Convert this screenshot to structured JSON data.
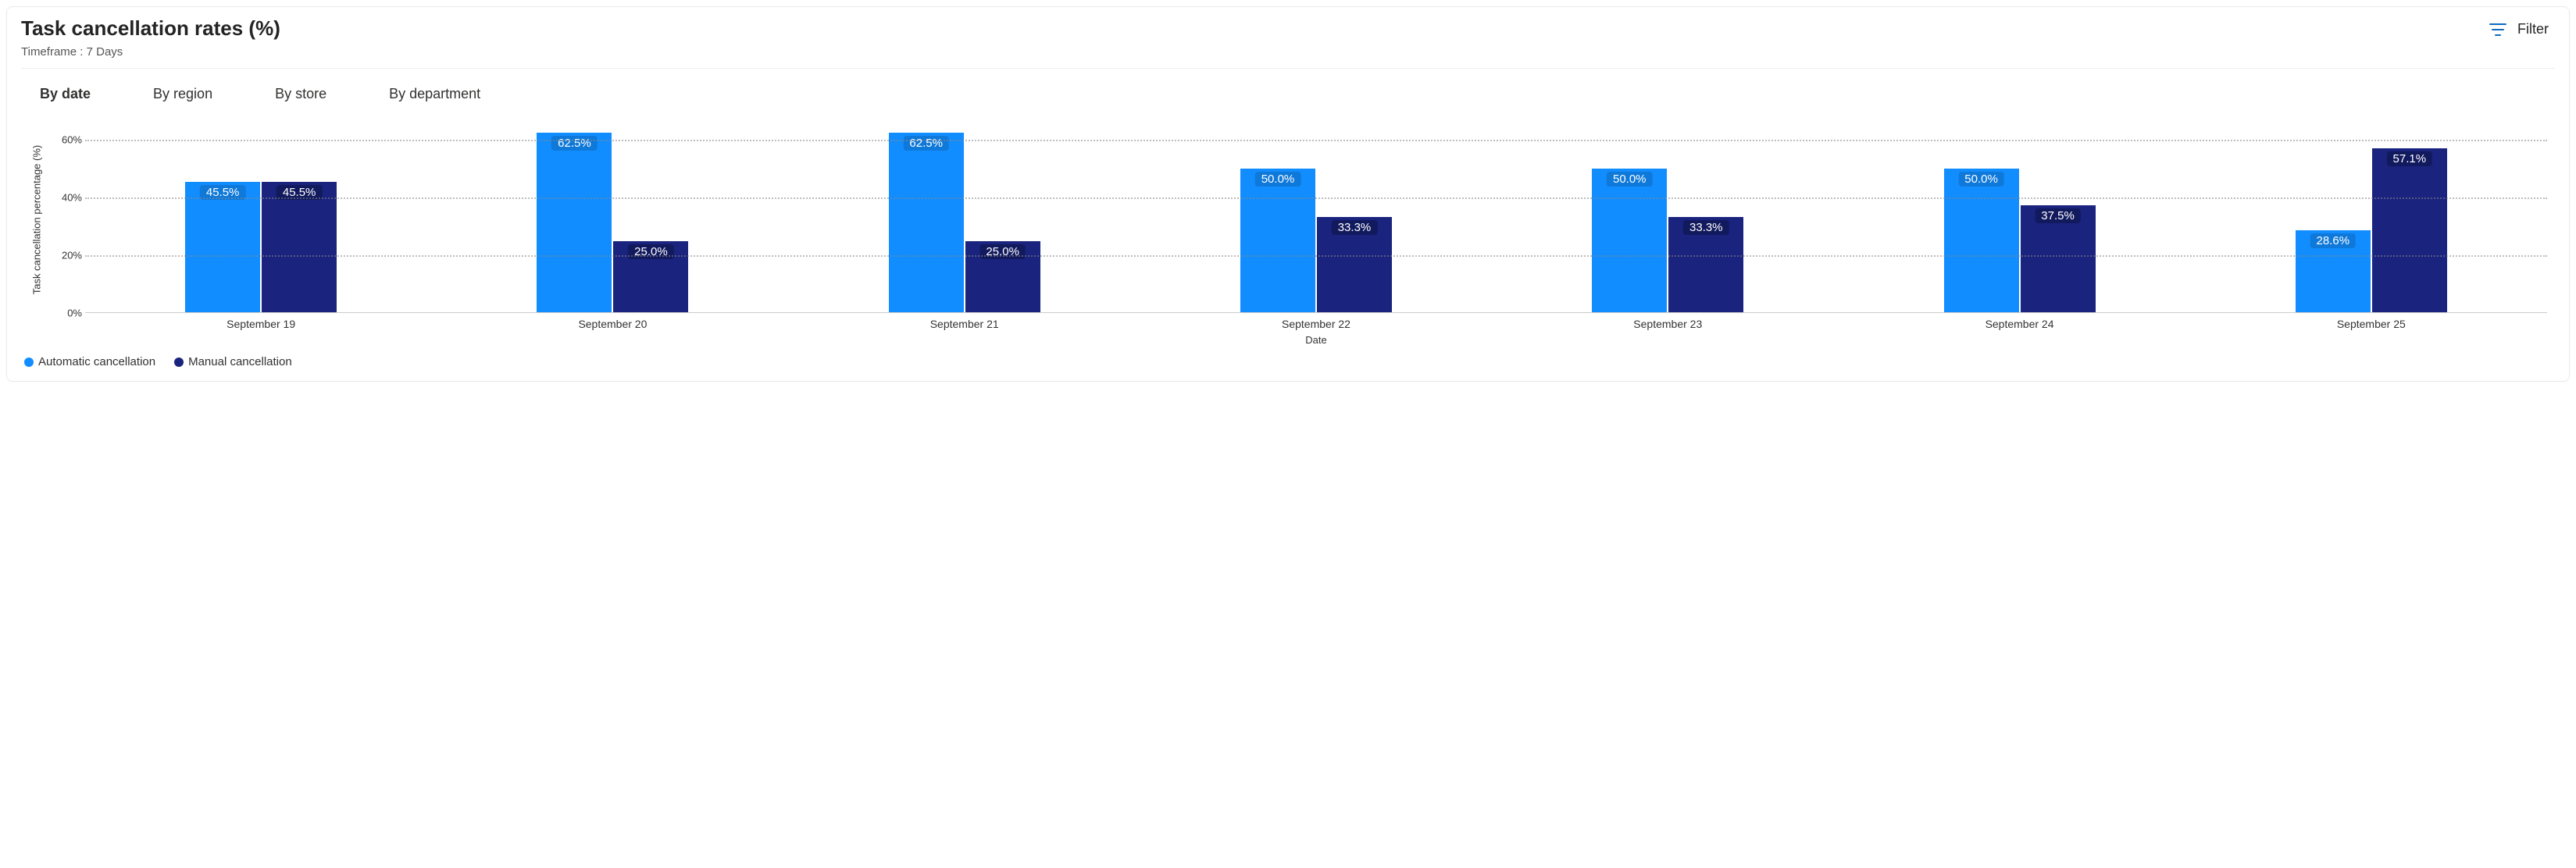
{
  "header": {
    "title": "Task cancellation rates (%)",
    "subtitle": "Timeframe : 7 Days",
    "filter_label": "Filter"
  },
  "tabs": {
    "items": [
      {
        "id": "by-date",
        "label": "By date",
        "active": true
      },
      {
        "id": "by-region",
        "label": "By region",
        "active": false
      },
      {
        "id": "by-store",
        "label": "By store",
        "active": false
      },
      {
        "id": "by-department",
        "label": "By department",
        "active": false
      }
    ]
  },
  "legend": {
    "auto": "Automatic cancellation",
    "manual": "Manual cancellation"
  },
  "axes": {
    "y_label": "Task cancellation percentage (%)",
    "x_label": "Date",
    "y_ticks": [
      "0%",
      "20%",
      "40%",
      "60%"
    ],
    "y_max": 65
  },
  "chart_data": {
    "type": "bar",
    "title": "Task cancellation rates (%)",
    "xlabel": "Date",
    "ylabel": "Task cancellation percentage (%)",
    "ylim": [
      0,
      65
    ],
    "categories": [
      "September 19",
      "September 20",
      "September 21",
      "September 22",
      "September 23",
      "September 24",
      "September 25"
    ],
    "series": [
      {
        "name": "Automatic cancellation",
        "color": "#118dff",
        "values": [
          45.5,
          62.5,
          62.5,
          50.0,
          50.0,
          50.0,
          28.6
        ],
        "labels": [
          "45.5%",
          "62.5%",
          "62.5%",
          "50.0%",
          "50.0%",
          "50.0%",
          "28.6%"
        ]
      },
      {
        "name": "Manual cancellation",
        "color": "#1a237e",
        "values": [
          45.5,
          25.0,
          25.0,
          33.3,
          33.3,
          37.5,
          57.1
        ],
        "labels": [
          "45.5%",
          "25.0%",
          "25.0%",
          "33.3%",
          "33.3%",
          "37.5%",
          "57.1%"
        ]
      }
    ]
  }
}
